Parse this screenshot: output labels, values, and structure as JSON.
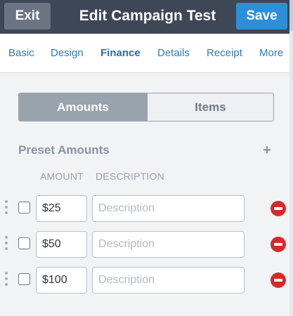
{
  "header": {
    "exit_label": "Exit",
    "title": "Edit Campaign Test",
    "save_label": "Save"
  },
  "tabs": [
    {
      "label": "Basic",
      "active": false
    },
    {
      "label": "Design",
      "active": false
    },
    {
      "label": "Finance",
      "active": true
    },
    {
      "label": "Details",
      "active": false
    },
    {
      "label": "Receipt",
      "active": false
    },
    {
      "label": "More",
      "active": false
    }
  ],
  "segment": {
    "options": [
      "Amounts",
      "Items"
    ],
    "selected": "Amounts"
  },
  "preset": {
    "title": "Preset Amounts",
    "columns": [
      "AMOUNT",
      "DESCRIPTION"
    ],
    "rows": [
      {
        "amount": "$25",
        "description": "",
        "checked": false
      },
      {
        "amount": "$50",
        "description": "",
        "checked": false
      },
      {
        "amount": "$100",
        "description": "",
        "checked": false
      }
    ],
    "description_placeholder": "Description"
  },
  "colors": {
    "header_bg": "#3e4756",
    "save_blue": "#2d8fd8",
    "tab_link": "#2f7cb8",
    "segment_active": "#98a3ae",
    "remove_red": "#d42a2a"
  },
  "icons": {
    "add": "plus-icon",
    "remove": "minus-circle-icon",
    "drag": "drag-handle-icon"
  }
}
